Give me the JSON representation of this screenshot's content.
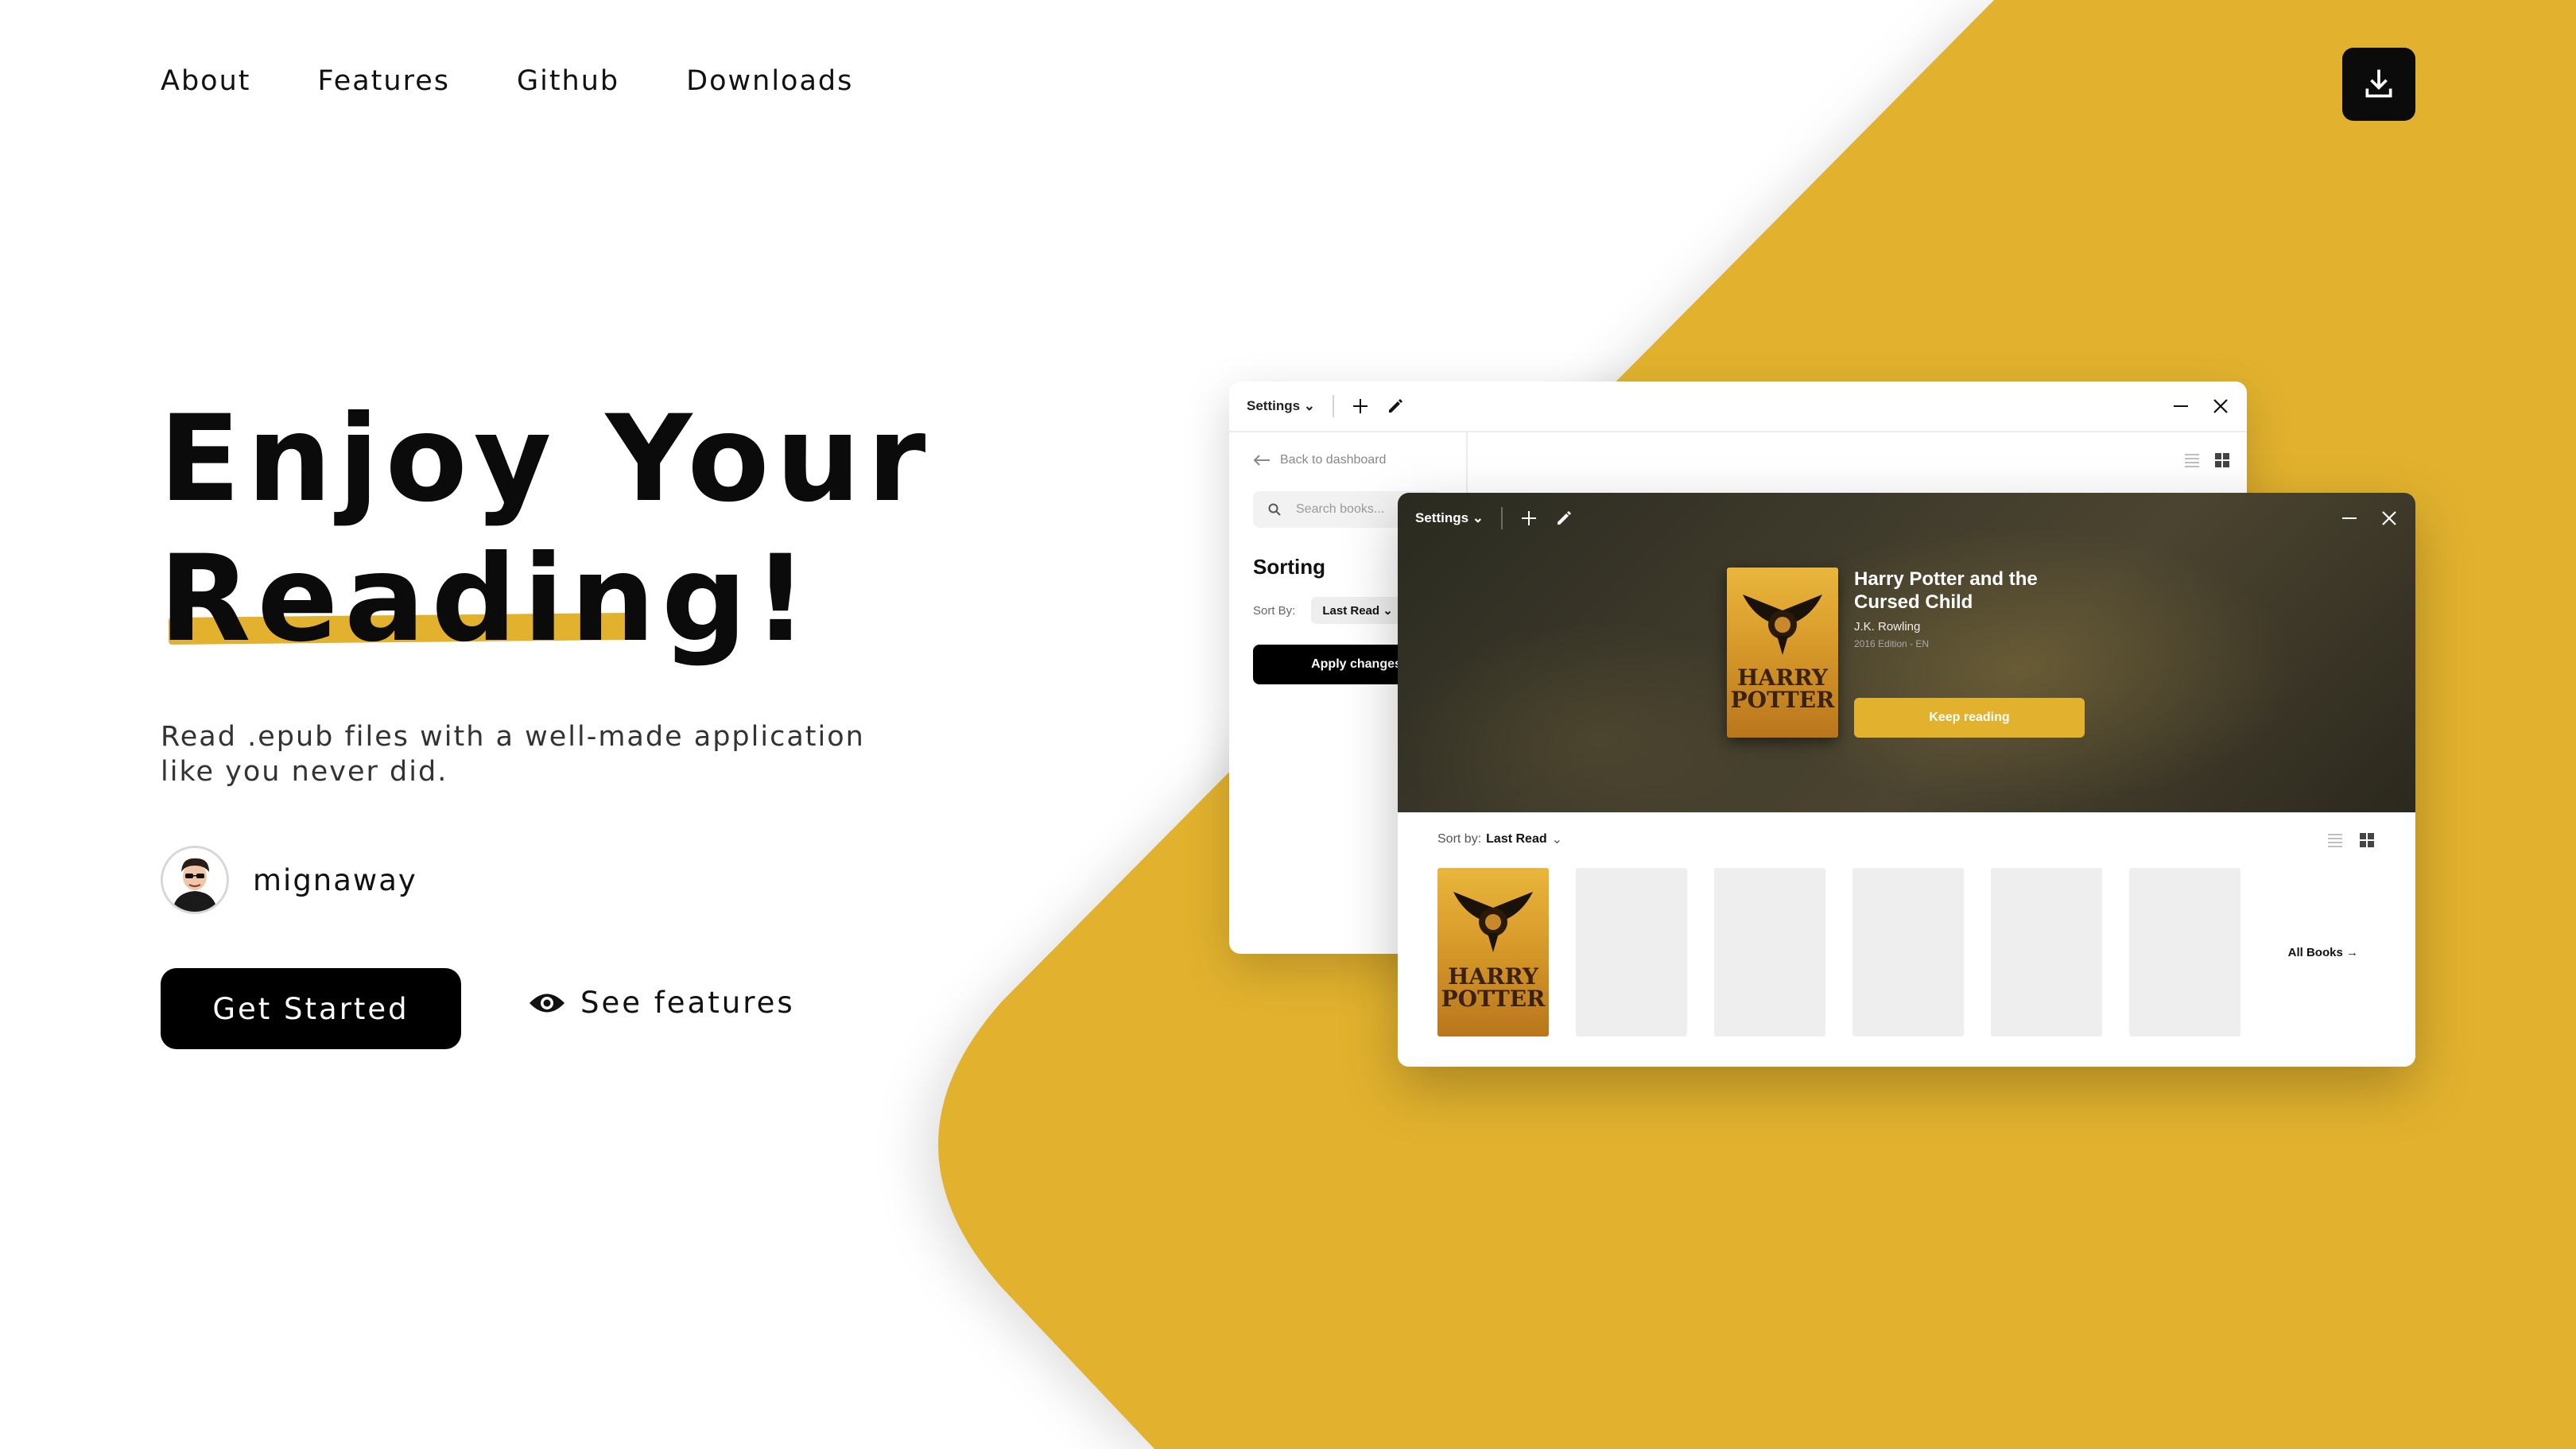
{
  "nav": {
    "items": [
      "About",
      "Features",
      "Github",
      "Downloads"
    ]
  },
  "download_button": {
    "icon": "download-icon"
  },
  "hero": {
    "title_line1": "Enjoy Your",
    "title_line2_word": "Reading",
    "title_line2_punct": "!",
    "subtitle": "Read .epub files with a well-made application like you never did."
  },
  "author": {
    "name": "mignaway"
  },
  "buttons": {
    "get_started": "Get Started",
    "see_features": "See features"
  },
  "app_back": {
    "menu": "Settings",
    "back_link": "Back to dashboard",
    "search_placeholder": "Search books...",
    "sorting_title": "Sorting",
    "sort_by_label": "Sort By:",
    "sort_by_value": "Last Read",
    "apply": "Apply changes"
  },
  "app_front": {
    "menu": "Settings",
    "book": {
      "title": "Harry Potter and the Cursed Child",
      "author": "J.K. Rowling",
      "edition": "2016 Edition - EN",
      "cover_line1": "HARRY",
      "cover_line2": "POTTER"
    },
    "keep_reading": "Keep reading",
    "sort_by_label": "Sort by:",
    "sort_by_value": "Last Read",
    "all_books": "All Books →"
  },
  "colors": {
    "accent": "#E2B22F",
    "dark": "#0B0B0B",
    "background": "#FFFFFF"
  }
}
